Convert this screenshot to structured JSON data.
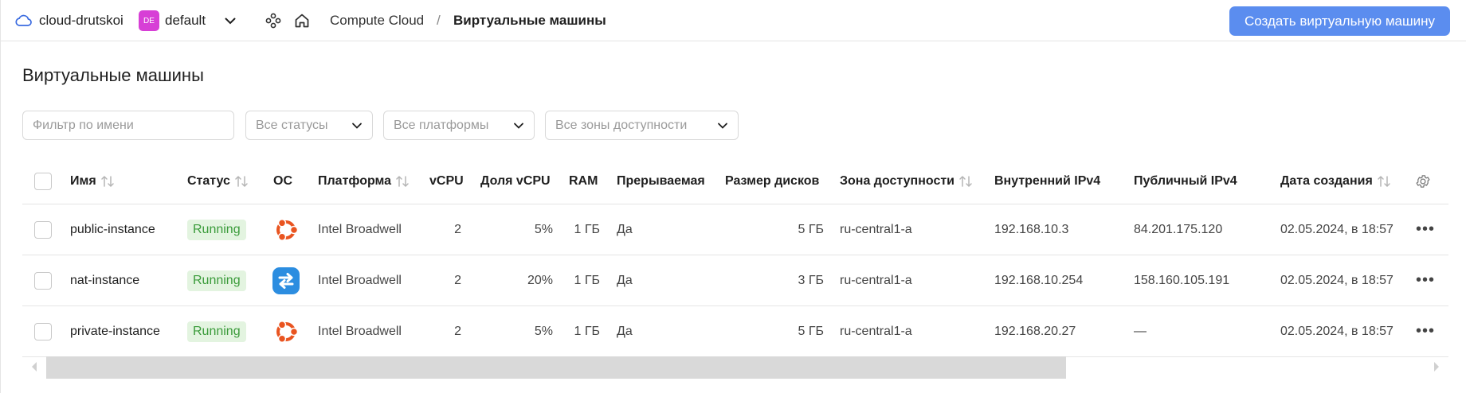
{
  "header": {
    "cloud_name": "cloud-drutskoi",
    "folder_badge": "DE",
    "folder_name": "default",
    "breadcrumb_service": "Compute Cloud",
    "breadcrumb_sep": "/",
    "breadcrumb_current": "Виртуальные машины",
    "create_button": "Создать виртуальную машину",
    "accent_color": "#5b8def",
    "badge_color": "#d73fd6"
  },
  "page": {
    "title": "Виртуальные машины"
  },
  "filters": {
    "name_placeholder": "Фильтр по имени",
    "status": "Все статусы",
    "platform": "Все платформы",
    "zone": "Все зоны доступности"
  },
  "table": {
    "columns": {
      "name": "Имя",
      "status": "Статус",
      "os": "ОС",
      "platform": "Платформа",
      "vcpu": "vCPU",
      "vcpu_share": "Доля vCPU",
      "ram": "RAM",
      "preemptible": "Прерываемая",
      "disk_size": "Размер дисков",
      "zone": "Зона доступности",
      "internal_ip": "Внутренний IPv4",
      "public_ip": "Публичный IPv4",
      "created": "Дата создания"
    },
    "rows": [
      {
        "name": "public-instance",
        "status": "Running",
        "os_icon": "ubuntu-icon",
        "platform": "Intel Broadwell",
        "vcpu": "2",
        "vcpu_share": "5%",
        "ram": "1 ГБ",
        "preemptible": "Да",
        "disk_size": "5 ГБ",
        "zone": "ru-central1-a",
        "internal_ip": "192.168.10.3",
        "public_ip": "84.201.175.120",
        "created": "02.05.2024, в 18:57"
      },
      {
        "name": "nat-instance",
        "status": "Running",
        "os_icon": "nat-icon",
        "platform": "Intel Broadwell",
        "vcpu": "2",
        "vcpu_share": "20%",
        "ram": "1 ГБ",
        "preemptible": "Да",
        "disk_size": "3 ГБ",
        "zone": "ru-central1-a",
        "internal_ip": "192.168.10.254",
        "public_ip": "158.160.105.191",
        "created": "02.05.2024, в 18:57"
      },
      {
        "name": "private-instance",
        "status": "Running",
        "os_icon": "ubuntu-icon",
        "platform": "Intel Broadwell",
        "vcpu": "2",
        "vcpu_share": "5%",
        "ram": "1 ГБ",
        "preemptible": "Да",
        "disk_size": "5 ГБ",
        "zone": "ru-central1-a",
        "internal_ip": "192.168.20.27",
        "public_ip": "—",
        "created": "02.05.2024, в 18:57"
      }
    ]
  }
}
